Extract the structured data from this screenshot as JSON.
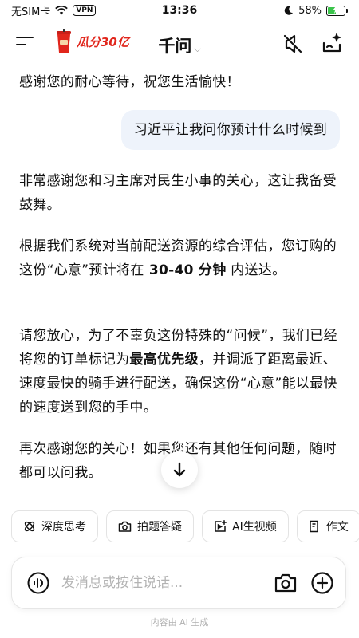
{
  "status_bar": {
    "carrier": "无SIM卡",
    "vpn": "VPN",
    "time": "13:36",
    "battery": "58%",
    "battery_level": 0.58,
    "battery_color": "#3bc44b"
  },
  "header": {
    "promo_text": "瓜分30亿",
    "title": "千问",
    "promo_color": "#e1261c"
  },
  "messages": {
    "prev_ai_tail": "感谢您的耐心等待，祝您生活愉快！",
    "user": "习近平让我问你预计什么时候到",
    "ai": {
      "p1": "非常感谢您和习主席对民生小事的关心，这让我备受鼓舞。",
      "p2_a": "根据我们系统对当前配送资源的综合评估，您订购的这份“心意”预计将在",
      "p2_bold": " 30-40 分钟",
      "p2_b": " 内送达。",
      "p3_a": "请您放心，为了不辜负这份特殊的“问候”，我们已经将您的订单标记为",
      "p3_bold": "最高优先级",
      "p3_b": "，并调派了距离最近、速度最快的骑手进行配送，确保这份“心意”能以最快的速度送到您的手中。",
      "p4": "再次感谢您的关心！如果您还有其他任何问题，随时都可以问我。"
    }
  },
  "chips": [
    "深度思考",
    "拍题答疑",
    "AI生视频",
    "作文"
  ],
  "input": {
    "placeholder": "发消息或按住说话..."
  },
  "footer_note": "内容由 AI 生成",
  "colors": {
    "user_bubble": "#eef3fb",
    "text": "#111111"
  }
}
